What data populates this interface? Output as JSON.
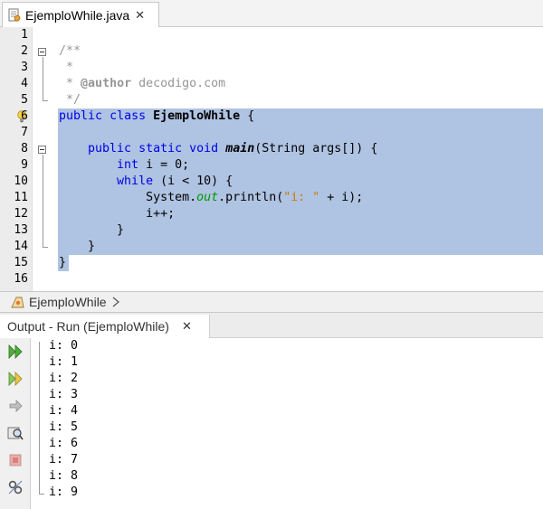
{
  "editor_tab": {
    "label": "EjemploWhile.java",
    "close": "✕"
  },
  "editor": {
    "line_numbers": [
      "1",
      "2",
      "3",
      "4",
      "5",
      "6",
      "7",
      "8",
      "9",
      "10",
      "11",
      "12",
      "13",
      "14",
      "15",
      "16"
    ],
    "comment_open": "/**",
    "comment_star": "*",
    "author_tag": "@author",
    "author_value": "decodigo.com",
    "comment_close": "*/",
    "kw_public": "public",
    "kw_class": "class",
    "class_name": "EjemploWhile",
    "open_brace": "{",
    "kw_static": "static",
    "kw_void": "void",
    "method_name": "main",
    "method_params": "(String args[]) {",
    "kw_int": "int",
    "init_stmt": " i = 0;",
    "kw_while": "while",
    "while_cond": " (i < 10) {",
    "sys_prefix": "System.",
    "sys_out": "out",
    "println_prefix": ".println(",
    "string_literal": "\"i: \"",
    "println_suffix": " + i);",
    "increment": "i++;",
    "close_brace": "}"
  },
  "breadcrumb": {
    "label": "EjemploWhile"
  },
  "output_tab": {
    "label": "Output - Run (EjemploWhile)",
    "close": "✕"
  },
  "output_lines": [
    "i: 0",
    "i: 1",
    "i: 2",
    "i: 3",
    "i: 4",
    "i: 5",
    "i: 6",
    "i: 7",
    "i: 8",
    "i: 9"
  ],
  "icons": {
    "file": "java-file-icon",
    "hint": "lightbulb-icon",
    "breadcrumb": "class-icon",
    "rerun": "rerun-icon",
    "rerun_customized": "rerun-customized-icon",
    "step": "step-icon",
    "profile": "profile-icon",
    "stop": "stop-icon",
    "settings": "settings-icon"
  },
  "colors": {
    "keyword": "#0000e6",
    "comment": "#969696",
    "string": "#ce7b00",
    "field": "#009900",
    "selection": "#afc3e2"
  }
}
